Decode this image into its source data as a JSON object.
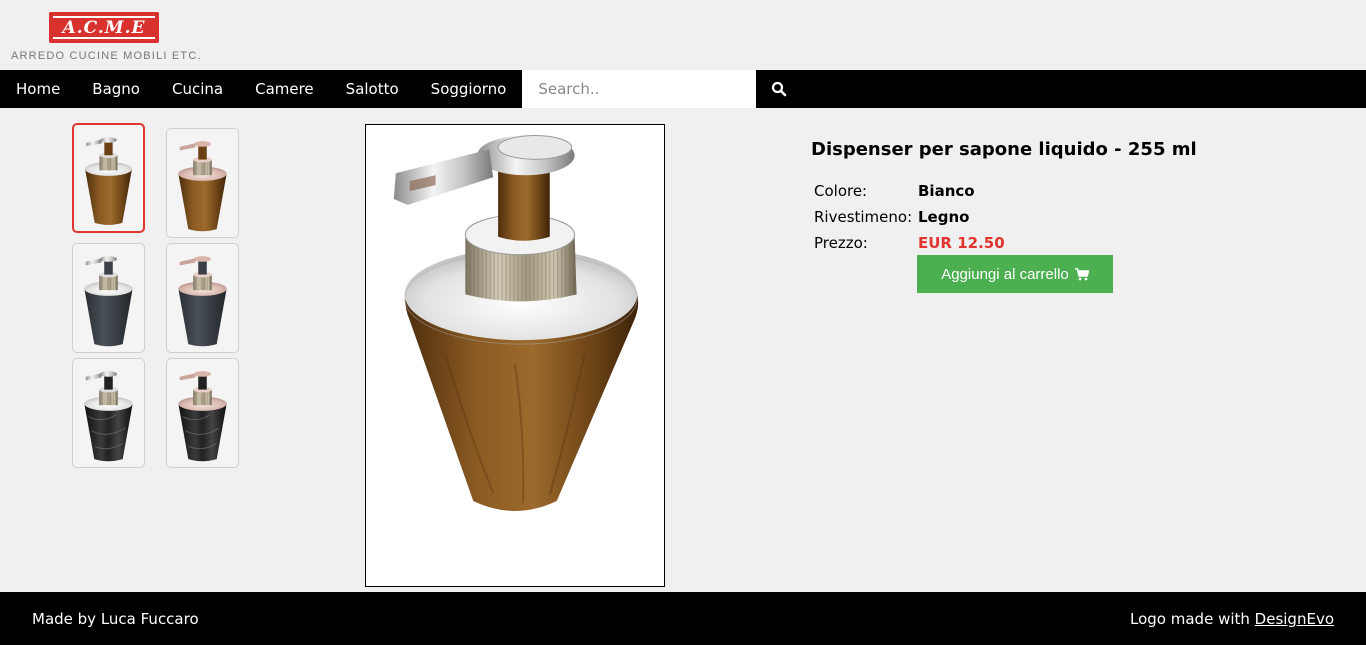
{
  "logo": {
    "text": "A.C.M.E",
    "subtitle": "ARREDO CUCINE MOBILI ETC."
  },
  "nav": {
    "items": [
      {
        "label": "Home"
      },
      {
        "label": "Bagno"
      },
      {
        "label": "Cucina"
      },
      {
        "label": "Camere"
      },
      {
        "label": "Salotto"
      },
      {
        "label": "Soggiorno"
      }
    ],
    "search_placeholder": "Search..",
    "search_icon": "search-icon"
  },
  "thumbnails": [
    {
      "variant": "wood-white",
      "selected": true
    },
    {
      "variant": "wood-rose",
      "selected": false
    },
    {
      "variant": "slate-white",
      "selected": false
    },
    {
      "variant": "slate-rose",
      "selected": false
    },
    {
      "variant": "marble-white",
      "selected": false
    },
    {
      "variant": "marble-rose",
      "selected": false
    }
  ],
  "product": {
    "title": "Dispenser per sapone liquido - 255 ml",
    "specs": [
      {
        "label": "Colore:",
        "value": "Bianco"
      },
      {
        "label": "Rivestimeno:",
        "value": "Legno"
      },
      {
        "label": "Prezzo:",
        "value": "EUR 12.50"
      }
    ],
    "add_to_cart_label": "Aggiungi al carrello",
    "cart_icon": "cart-icon"
  },
  "footer": {
    "left_text": "Made by Luca Fuccaro",
    "right_prefix": "Logo made with ",
    "right_link": "DesignEvo"
  },
  "colors": {
    "accent_red": "#e0362f",
    "button_green": "#4caf50",
    "nav_bg": "#000000",
    "page_bg": "#f0f0f0"
  }
}
